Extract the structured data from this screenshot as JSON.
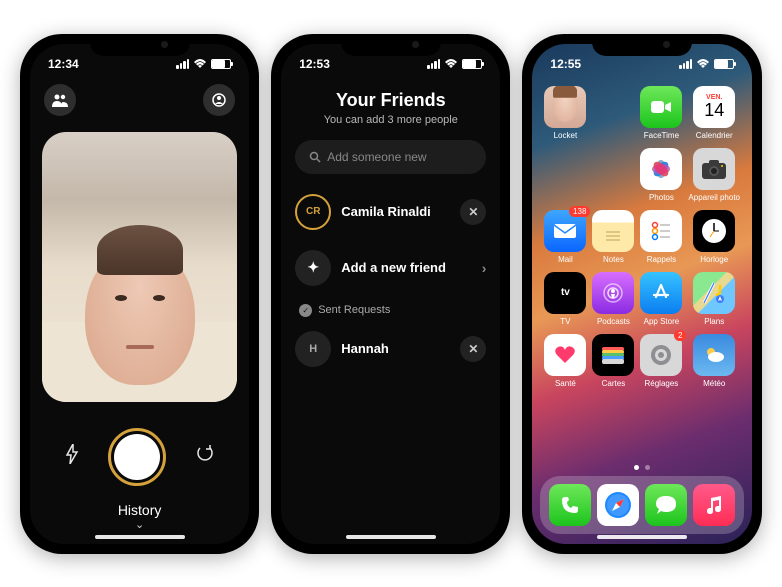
{
  "phone1": {
    "time": "12:34",
    "history_label": "History"
  },
  "phone2": {
    "time": "12:53",
    "title": "Your Friends",
    "subtitle": "You can add 3 more people",
    "search_placeholder": "Add someone new",
    "friend_initials": "CR",
    "friend_name": "Camila Rinaldi",
    "add_friend_label": "Add a new friend",
    "sent_label": "Sent Requests",
    "pending_initial": "H",
    "pending_name": "Hannah"
  },
  "phone3": {
    "time": "12:55",
    "calendar_day": "VEN.",
    "calendar_num": "14",
    "badge_mail": "138",
    "badge_settings": "2",
    "apps_row1": [
      {
        "name": "locket",
        "label": "Locket"
      },
      {
        "name": "facetime",
        "label": "FaceTime"
      },
      {
        "name": "calendar",
        "label": "Calendrier"
      }
    ],
    "apps_row2": [
      {
        "name": "photos",
        "label": "Photos"
      },
      {
        "name": "camera",
        "label": "Appareil photo"
      }
    ],
    "apps_row3": [
      {
        "name": "mail",
        "label": "Mail"
      },
      {
        "name": "notes",
        "label": "Notes"
      },
      {
        "name": "reminders",
        "label": "Rappels"
      },
      {
        "name": "clock",
        "label": "Horloge"
      }
    ],
    "apps_row4": [
      {
        "name": "tv",
        "label": "TV"
      },
      {
        "name": "podcasts",
        "label": "Podcasts"
      },
      {
        "name": "appstore",
        "label": "App Store"
      },
      {
        "name": "plans",
        "label": "Plans"
      }
    ],
    "apps_row5": [
      {
        "name": "health",
        "label": "Santé"
      },
      {
        "name": "wallet",
        "label": "Cartes"
      },
      {
        "name": "settings",
        "label": "Réglages"
      },
      {
        "name": "weather",
        "label": "Météo"
      }
    ]
  }
}
